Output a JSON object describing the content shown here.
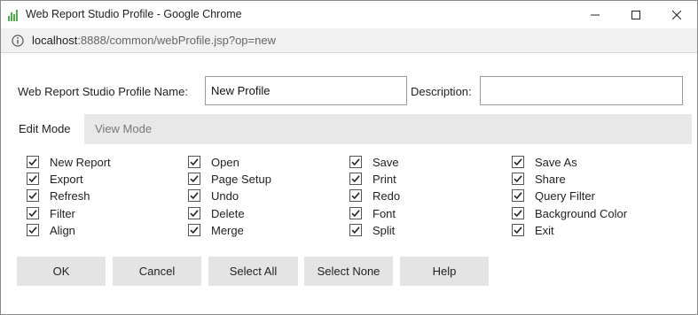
{
  "window": {
    "title": "Web Report Studio Profile - Google Chrome"
  },
  "address": {
    "host": "localhost",
    "path": ":8888/common/webProfile.jsp?op=new"
  },
  "form": {
    "profile_name_label": "Web Report Studio Profile Name:",
    "profile_name_value": "New Profile",
    "description_label": "Description:",
    "description_value": ""
  },
  "tabs": [
    {
      "label": "Edit Mode",
      "active": true
    },
    {
      "label": "View Mode",
      "active": false
    }
  ],
  "options": {
    "col1": [
      {
        "label": "New Report",
        "checked": true
      },
      {
        "label": "Export",
        "checked": true
      },
      {
        "label": "Refresh",
        "checked": true
      },
      {
        "label": "Filter",
        "checked": true
      },
      {
        "label": "Align",
        "checked": true
      }
    ],
    "col2": [
      {
        "label": "Open",
        "checked": true
      },
      {
        "label": "Page Setup",
        "checked": true
      },
      {
        "label": "Undo",
        "checked": true
      },
      {
        "label": "Delete",
        "checked": true
      },
      {
        "label": "Merge",
        "checked": true
      }
    ],
    "col3": [
      {
        "label": "Save",
        "checked": true
      },
      {
        "label": "Print",
        "checked": true
      },
      {
        "label": "Redo",
        "checked": true
      },
      {
        "label": "Font",
        "checked": true
      },
      {
        "label": "Split",
        "checked": true
      }
    ],
    "col4": [
      {
        "label": "Save As",
        "checked": true
      },
      {
        "label": "Share",
        "checked": true
      },
      {
        "label": "Query Filter",
        "checked": true
      },
      {
        "label": "Background Color",
        "checked": true
      },
      {
        "label": "Exit",
        "checked": true
      }
    ]
  },
  "buttons": {
    "ok": "OK",
    "cancel": "Cancel",
    "select_all": "Select All",
    "select_none": "Select None",
    "help": "Help"
  },
  "colors": {
    "app_icon": "#4caf50",
    "tab_strip": "#e8e8e8",
    "button_bg": "#e4e4e4"
  }
}
